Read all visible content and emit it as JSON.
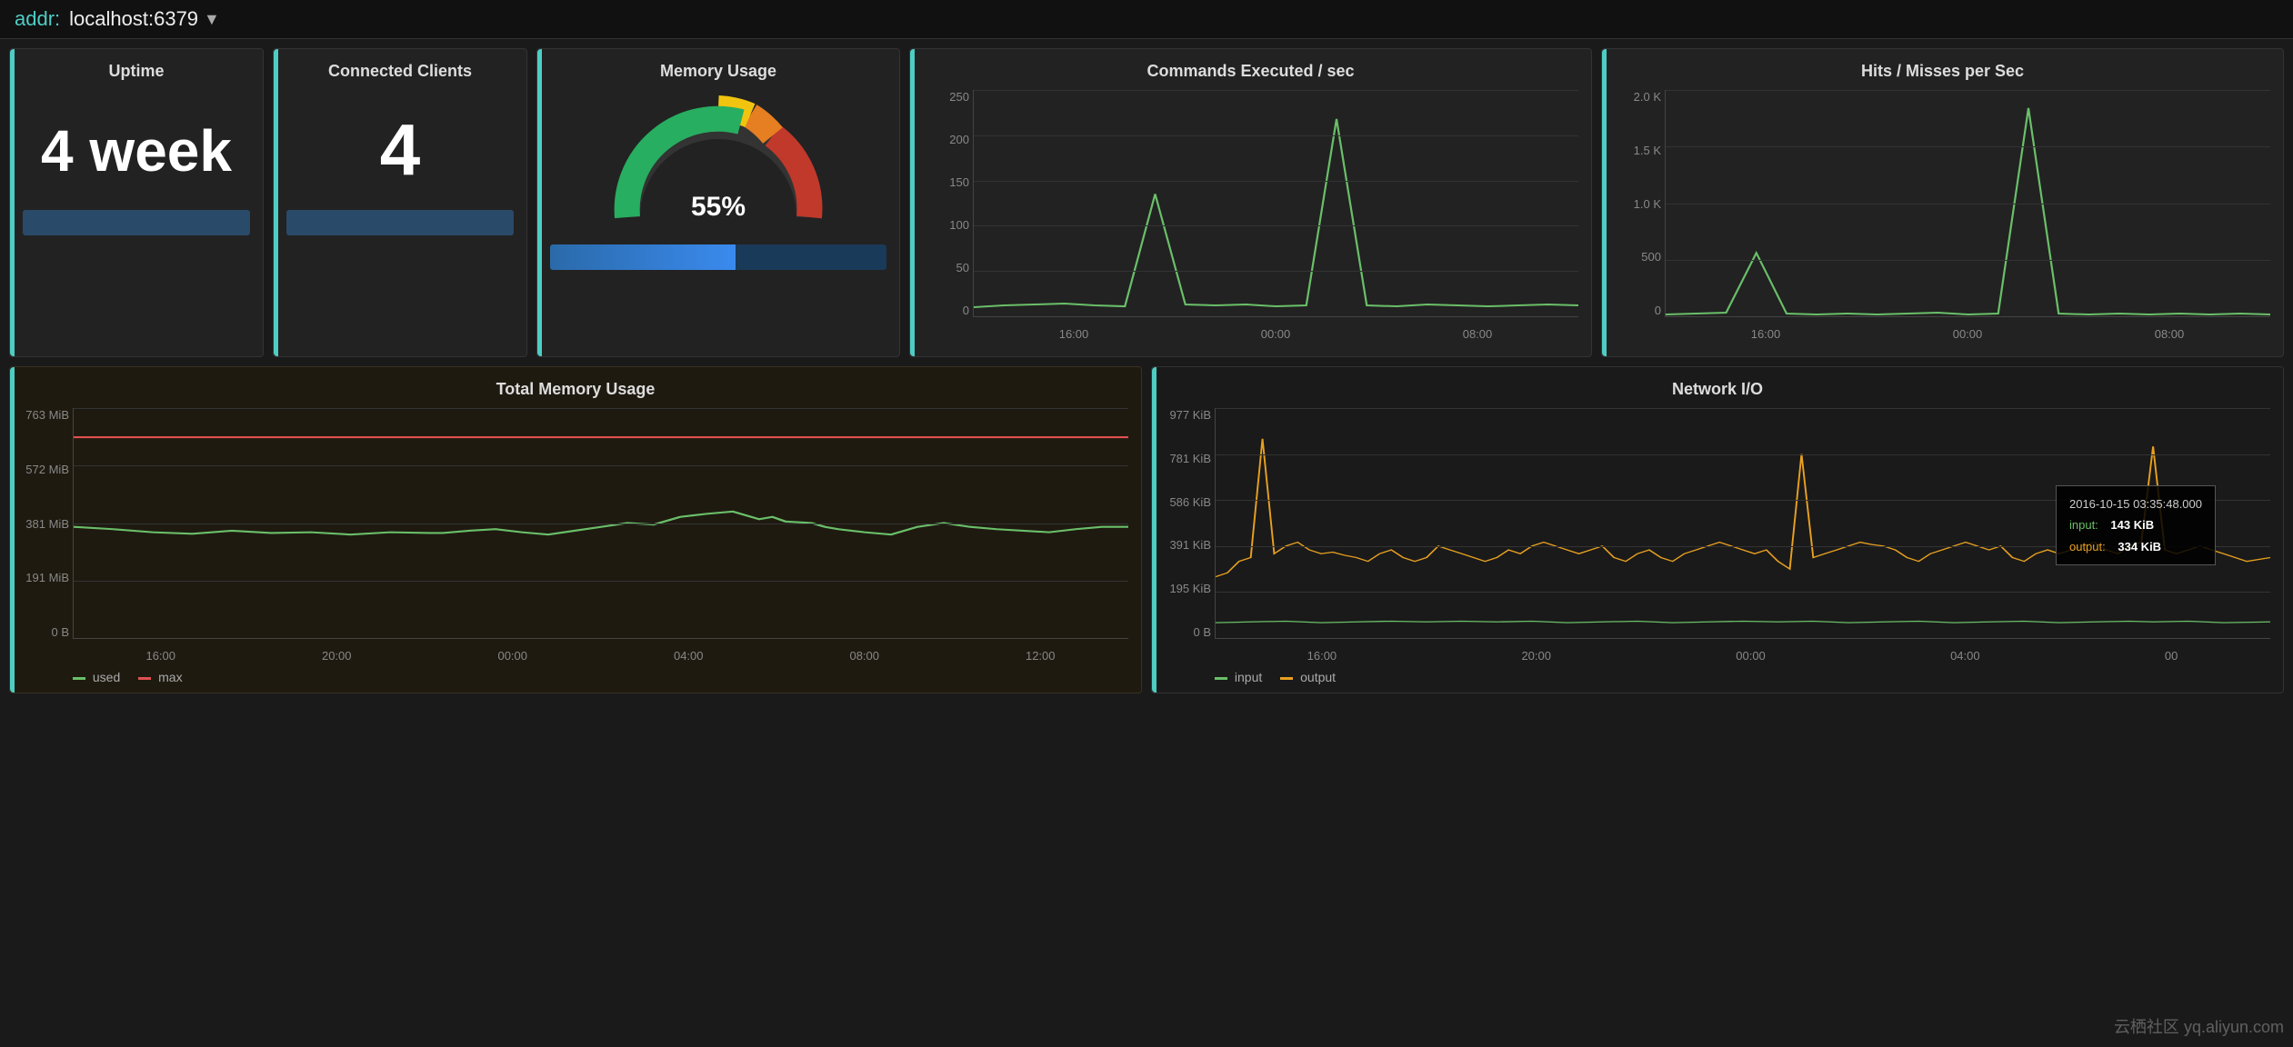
{
  "header": {
    "addr_label": "addr:",
    "addr_value": "localhost:6379",
    "dropdown_icon": "▼"
  },
  "uptime_card": {
    "title": "Uptime",
    "value": "4 week",
    "accent_color": "#4ecdc4"
  },
  "clients_card": {
    "title": "Connected Clients",
    "value": "4",
    "accent_color": "#4ecdc4"
  },
  "memory_usage_card": {
    "title": "Memory Usage",
    "percent": "55%",
    "accent_color": "#4ecdc4"
  },
  "commands_chart": {
    "title": "Commands Executed / sec",
    "y_labels": [
      "250",
      "200",
      "150",
      "100",
      "50",
      "0"
    ],
    "x_labels": [
      "16:00",
      "00:00",
      "08:00"
    ],
    "accent_color": "#4ecdc4"
  },
  "hits_misses_chart": {
    "title": "Hits / Misses per Sec",
    "y_labels": [
      "2.0 K",
      "1.5 K",
      "1.0 K",
      "500",
      "0"
    ],
    "x_labels": [
      "16:00",
      "00:00",
      "08:00"
    ],
    "accent_color": "#4ecdc4"
  },
  "total_memory_chart": {
    "title": "Total Memory Usage",
    "y_labels": [
      "763 MiB",
      "572 MiB",
      "381 MiB",
      "191 MiB",
      "0 B"
    ],
    "x_labels": [
      "16:00",
      "20:00",
      "00:00",
      "04:00",
      "08:00",
      "12:00"
    ],
    "legend": [
      {
        "label": "used",
        "color": "#6abf69"
      },
      {
        "label": "max",
        "color": "#e05050"
      }
    ],
    "accent_color": "#4ecdc4"
  },
  "network_io_chart": {
    "title": "Network I/O",
    "y_labels": [
      "977 KiB",
      "781 KiB",
      "586 KiB",
      "391 KiB",
      "195 KiB",
      "0 B"
    ],
    "x_labels": [
      "16:00",
      "20:00",
      "00:00",
      "04:00",
      "00"
    ],
    "legend": [
      {
        "label": "input",
        "color": "#6abf69"
      },
      {
        "label": "output",
        "color": "#e8a020"
      }
    ],
    "tooltip": {
      "timestamp": "2016-10-15 03:35:48.000",
      "input_label": "input:",
      "input_value": "143 KiB",
      "output_label": "output:",
      "output_value": "334 KiB"
    },
    "accent_color": "#4ecdc4"
  },
  "watermark": "云栖社区 yq.aliyun.com"
}
